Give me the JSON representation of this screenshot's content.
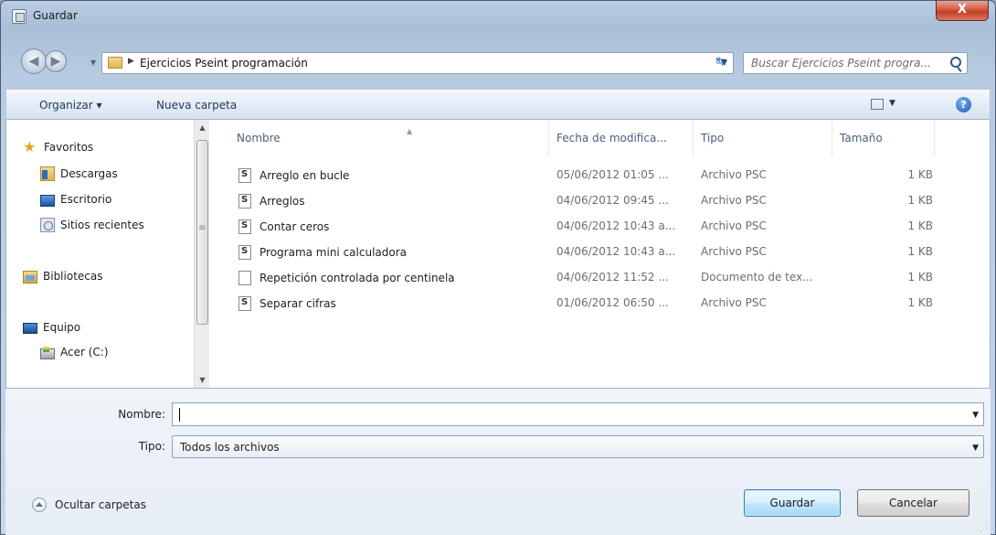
{
  "window": {
    "title": "Guardar",
    "close_label": "X"
  },
  "address": {
    "path": "Ejercicios Pseint programación",
    "search_placeholder": "Buscar Ejercicios Pseint progra..."
  },
  "toolbar": {
    "organize_label": "Organizar ▾",
    "new_folder_label": "Nueva carpeta",
    "help_label": "?"
  },
  "sidebar": {
    "items": [
      {
        "label": "Favoritos",
        "icon": "star-icon"
      },
      {
        "label": "Descargas",
        "icon": "downloads-folder-icon"
      },
      {
        "label": "Escritorio",
        "icon": "desktop-icon"
      },
      {
        "label": "Sitios recientes",
        "icon": "recent-places-icon"
      },
      {
        "label": "Bibliotecas",
        "icon": "libraries-icon"
      },
      {
        "label": "Equipo",
        "icon": "computer-icon"
      },
      {
        "label": "Acer (C:)",
        "icon": "drive-icon"
      }
    ]
  },
  "file_list": {
    "columns": [
      "Nombre",
      "Fecha de modifica...",
      "Tipo",
      "Tamaño"
    ],
    "rows": [
      {
        "name": "Arreglo en bucle",
        "date": "05/06/2012 01:05 ...",
        "type": "Archivo PSC",
        "size": "1 KB",
        "icon": "psc-file-icon"
      },
      {
        "name": "Arreglos",
        "date": "04/06/2012 09:45 ...",
        "type": "Archivo PSC",
        "size": "1 KB",
        "icon": "psc-file-icon"
      },
      {
        "name": "Contar ceros",
        "date": "04/06/2012 10:43 a...",
        "type": "Archivo PSC",
        "size": "1 KB",
        "icon": "psc-file-icon"
      },
      {
        "name": "Programa mini calculadora",
        "date": "04/06/2012 10:43 a...",
        "type": "Archivo PSC",
        "size": "1 KB",
        "icon": "psc-file-icon"
      },
      {
        "name": "Repetición controlada por centinela",
        "date": "04/06/2012 11:52 ...",
        "type": "Documento de tex...",
        "size": "1 KB",
        "icon": "text-file-icon"
      },
      {
        "name": "Separar cifras",
        "date": "01/06/2012 06:50 ...",
        "type": "Archivo PSC",
        "size": "1 KB",
        "icon": "psc-file-icon"
      }
    ]
  },
  "form": {
    "name_label": "Nombre:",
    "name_value": "",
    "type_label": "Tipo:",
    "type_value": "Todos los archivos"
  },
  "footer": {
    "hide_folders_label": "Ocultar carpetas",
    "save_label": "Guardar",
    "cancel_label": "Cancelar"
  },
  "colors": {
    "title_gradient": "#b9cde3",
    "save_button_border": "#3c7fb1",
    "close_button": "#c23d24"
  }
}
